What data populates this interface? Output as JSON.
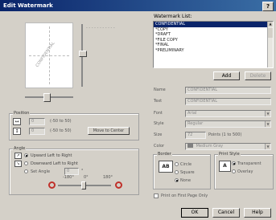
{
  "title": "Edit Watermark",
  "help_glyph": "?",
  "watermark_list": {
    "label": "Watermark List:",
    "items": [
      "CONFIDENTIAL",
      "*COPY",
      "*DRAFT",
      "*FILE COPY",
      "*FINAL",
      "*PRELIMINARY"
    ],
    "selected_index": 0
  },
  "preview_text": "CONFIDENTIAL",
  "add_label": "Add",
  "delete_label": "Delete",
  "name": {
    "label": "Name",
    "value": "CONFIDENTIAL"
  },
  "text": {
    "label": "Text",
    "value": "CONFIDENTIAL"
  },
  "font": {
    "label": "Font",
    "value": "Arial"
  },
  "style": {
    "label": "Style",
    "value": "Regular"
  },
  "size": {
    "label": "Size",
    "value": "72",
    "range": "Points (1 to 500)"
  },
  "color": {
    "label": "Color",
    "value": "Medium Gray"
  },
  "border": {
    "label": "Border",
    "options": [
      "Circle",
      "Square",
      "None"
    ],
    "selected": 2,
    "sample": "AB"
  },
  "print_style": {
    "label": "Print Style",
    "options": [
      "Transparent",
      "Overlay"
    ],
    "selected": 0
  },
  "position": {
    "label": "Position",
    "x_range": "(-50 to 50)",
    "y_range": "(-50 to 50)",
    "x_value": "0",
    "y_value": "0",
    "center_label": "Move to Center"
  },
  "angle": {
    "label": "Angle",
    "options": [
      "Upward Left to Right",
      "Downward Left to Right",
      "Set Angle"
    ],
    "selected": 0,
    "value": "0",
    "ticks": [
      "-180°",
      "0°",
      "180°"
    ]
  },
  "first_page": "Print on First Page Only",
  "ok_label": "OK",
  "cancel_label": "Cancel",
  "helpbtn_label": "Help"
}
